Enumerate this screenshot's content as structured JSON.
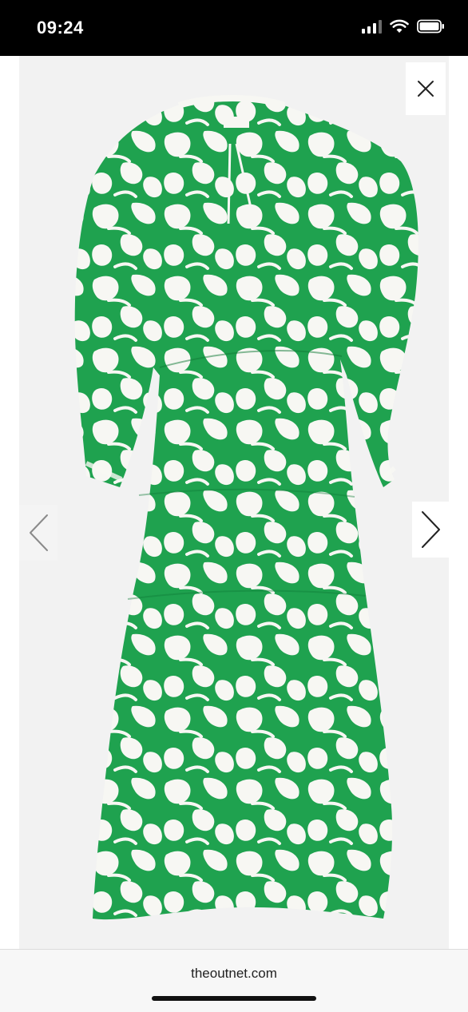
{
  "status_bar": {
    "time": "09:24",
    "icons": [
      "cellular-signal-icon",
      "wifi-icon",
      "battery-icon"
    ]
  },
  "viewer": {
    "close_icon": "close-icon",
    "prev_icon": "chevron-left-icon",
    "next_icon": "chevron-right-icon",
    "image": {
      "subject": "green-and-white-printed-tiered-midi-dress",
      "colors": {
        "green": "#1fa24f",
        "white": "#f7f7f3",
        "background": "#f2f2f2"
      }
    }
  },
  "browser": {
    "url": "theoutnet.com"
  }
}
